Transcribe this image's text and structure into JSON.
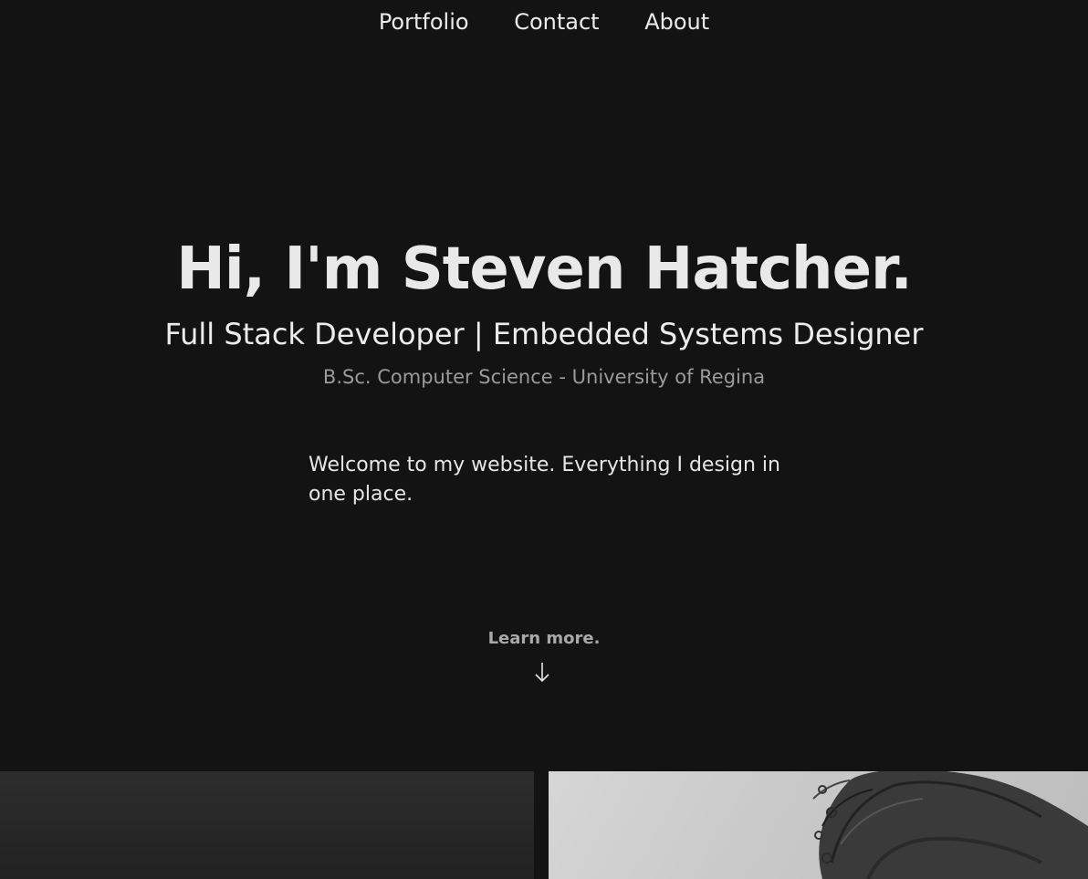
{
  "nav": {
    "items": [
      {
        "label": "Portfolio"
      },
      {
        "label": "Contact"
      },
      {
        "label": "About"
      }
    ]
  },
  "hero": {
    "title": "Hi, I'm Steven Hatcher.",
    "subtitle": "Full Stack Developer | Embedded Systems Designer",
    "degree": "B.Sc. Computer Science - University of Regina",
    "welcome": "Welcome to my website. Everything I design in one place.",
    "learn_more": "Learn more."
  },
  "icons": {
    "scroll": "arrow-down-icon"
  },
  "colors": {
    "background": "#131313",
    "text": "#e6e6e6",
    "muted": "#9a9a9a"
  }
}
